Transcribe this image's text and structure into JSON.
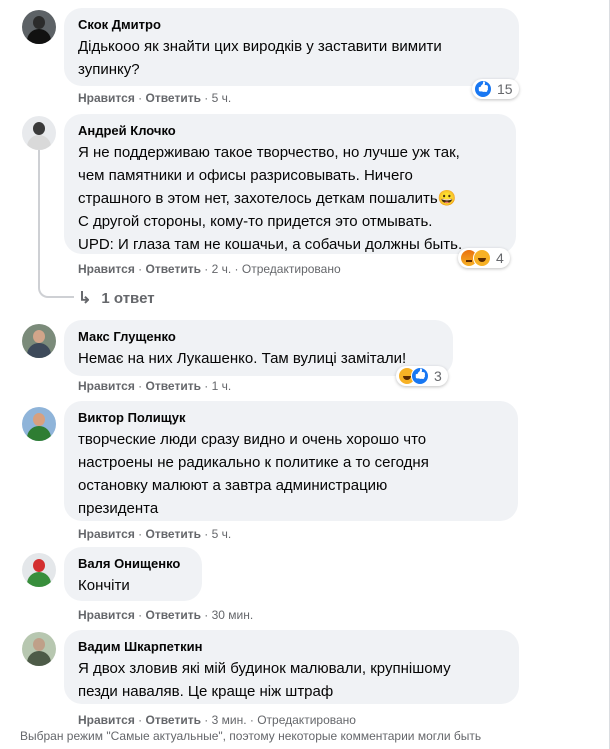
{
  "comments": [
    {
      "author": "Скок Дмитро",
      "text": "Дідькооо як знайти цих виродків у заставити вимити\nзупинку?",
      "like": "Нравится",
      "reply": "Ответить",
      "time": "5 ч.",
      "reaction_count": "15",
      "reaction_icons": [
        "like-icon"
      ]
    },
    {
      "author": "Андрей Клочко",
      "text": "Я не поддерживаю такое творчество, но лучше уж так,\nчем памятники и офисы разрисовывать. Ничего\nстрашного в этом нет, захотелось деткам пошалить😀\nС другой стороны, кому-то придется это отмывать.\nUPD: И глаза там не кошачьи, а собачьи должны быть.",
      "like": "Нравится",
      "reply": "Ответить",
      "time": "2 ч.",
      "edited": "Отредактировано",
      "reaction_count": "4",
      "reaction_icons": [
        "angry-icon",
        "haha-icon"
      ],
      "replies": "1 ответ"
    },
    {
      "author": "Макс Глущенко",
      "text": "Немає на них Лукашенко. Там вулиці замітали!",
      "like": "Нравится",
      "reply": "Ответить",
      "time": "1 ч.",
      "reaction_count": "3",
      "reaction_icons": [
        "haha-icon",
        "like-icon"
      ]
    },
    {
      "author": "Виктор Полищук",
      "text": "творческие люди сразу видно и очень хорошо что\nнастроены не радикально к политике а то сегодня\nостановку малюют а завтра администрацию\nпрезидента",
      "like": "Нравится",
      "reply": "Ответить",
      "time": "5 ч."
    },
    {
      "author": "Валя Онищенко",
      "text": "Кончіти",
      "like": "Нравится",
      "reply": "Ответить",
      "time": "30 мин."
    },
    {
      "author": "Вадим Шкарпеткин",
      "text": "Я двох зловив які мій будинок малювали, крупнішому\nпезди наваляв. Це краще ніж штраф",
      "like": "Нравится",
      "reply": "Ответить",
      "time": "3 мин.",
      "edited": "Отредактировано"
    }
  ],
  "footer": "Выбран режим \"Самые актуальные\", поэтому некоторые комментарии могли быть",
  "colors": {
    "like": "#1877f2",
    "bubble": "#f0f2f5",
    "meta": "#65676b",
    "haha": "#f7b125"
  }
}
